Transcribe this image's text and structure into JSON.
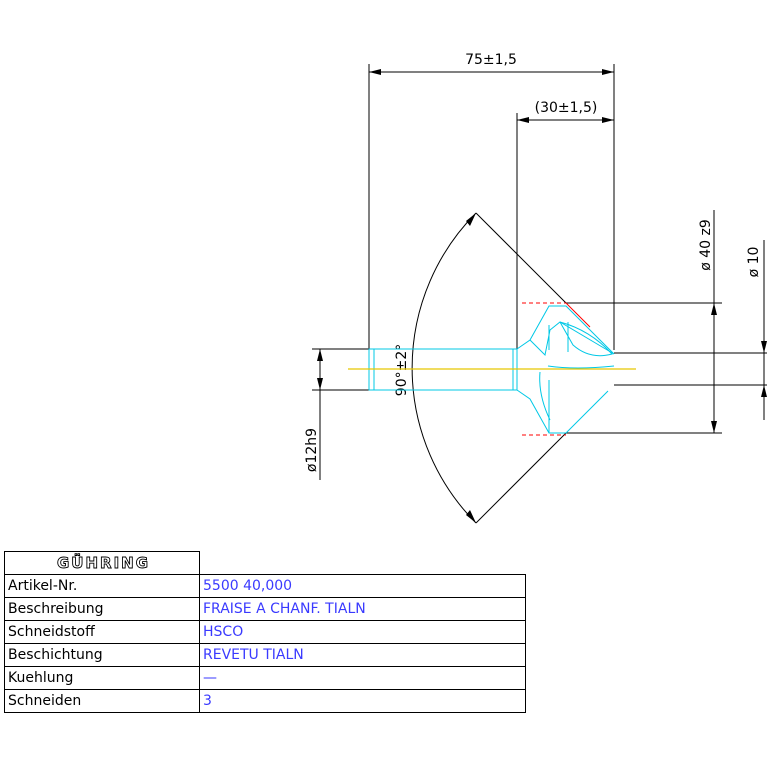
{
  "drawing": {
    "dim_overall_length": "75±1,5",
    "dim_head_length": "(30±1,5)",
    "dim_diameter_head": "ø 40 z9",
    "dim_diameter_tip": "ø 10",
    "dim_shank": "ø12h9",
    "dim_angle": "90°±2°"
  },
  "title_block": {
    "logo": "GÜHRING",
    "rows": [
      {
        "label": "Artikel-Nr.",
        "value": "5500 40,000"
      },
      {
        "label": "Beschreibung",
        "value": "FRAISE A CHANF. TIALN"
      },
      {
        "label": "Schneidstoff",
        "value": "HSCO"
      },
      {
        "label": "Beschichtung",
        "value": "REVETU TIALN"
      },
      {
        "label": "Kuehlung",
        "value": "—"
      },
      {
        "label": "Schneiden",
        "value": "3"
      }
    ]
  },
  "colors": {
    "outline": "#00c8e6",
    "centerline": "#e6c800",
    "hidden": "#ff0000",
    "value_text": "#3a3aff"
  }
}
